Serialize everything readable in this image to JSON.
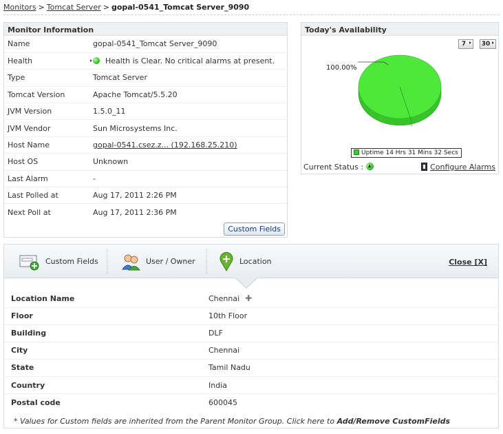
{
  "breadcrumb": {
    "monitors": "Monitors",
    "category": "Tomcat Server",
    "current": "gopal-0541_Tomcat Server_9090",
    "separator": ">"
  },
  "monitor_info": {
    "title": "Monitor Information",
    "rows": [
      {
        "label": "Name",
        "value": "gopal-0541_Tomcat Server_9090"
      },
      {
        "label": "Health",
        "value": "Health is Clear. No critical alarms at present."
      },
      {
        "label": "Type",
        "value": "Tomcat Server"
      },
      {
        "label": "Tomcat Version",
        "value": "Apache Tomcat/5.5.20"
      },
      {
        "label": "JVM Version",
        "value": "1.5.0_11"
      },
      {
        "label": "JVM Vendor",
        "value": "Sun Microsystems Inc."
      },
      {
        "label": "Host Name",
        "value": "gopal-0541.csez.z... (192.168.25.210)"
      },
      {
        "label": "Host OS",
        "value": "Unknown"
      },
      {
        "label": "Last Alarm",
        "value": "-"
      },
      {
        "label": "Last Polled at",
        "value": "Aug 17, 2011 2:26 PM"
      },
      {
        "label": "Next Poll at",
        "value": "Aug 17, 2011 2:36 PM"
      }
    ],
    "custom_fields_button": "Custom Fields"
  },
  "availability": {
    "title": "Today's Availability",
    "btn_7": "7",
    "btn_30": "30",
    "pie_label": "100.00%",
    "legend": "Uptime 14 Hrs 31 Mins 32 Secs",
    "current_status_label": "Current Status :",
    "configure_alarms": "Configure Alarms",
    "colors": {
      "uptime": "#4de83a"
    }
  },
  "chart_data": {
    "type": "pie",
    "categories": [
      "Uptime 14 Hrs 31 Mins 32 Secs"
    ],
    "values": [
      100.0
    ],
    "title": "Today's Availability"
  },
  "location_panel": {
    "tabs": {
      "custom_fields": "Custom Fields",
      "user_owner": "User / Owner",
      "location": "Location"
    },
    "close": "Close [X]",
    "rows": [
      {
        "label": "Location Name",
        "value": "Chennai"
      },
      {
        "label": "Floor",
        "value": "10th Floor"
      },
      {
        "label": "Building",
        "value": "DLF"
      },
      {
        "label": "City",
        "value": "Chennai"
      },
      {
        "label": "State",
        "value": "Tamil Nadu"
      },
      {
        "label": "Country",
        "value": "India"
      },
      {
        "label": "Postal code",
        "value": "600045"
      }
    ],
    "plus": "✚",
    "footnote_prefix": "* Values for Custom fields are inherited from the Parent Monitor Group. Click here to",
    "footnote_link": "Add/Remove CustomFields"
  }
}
